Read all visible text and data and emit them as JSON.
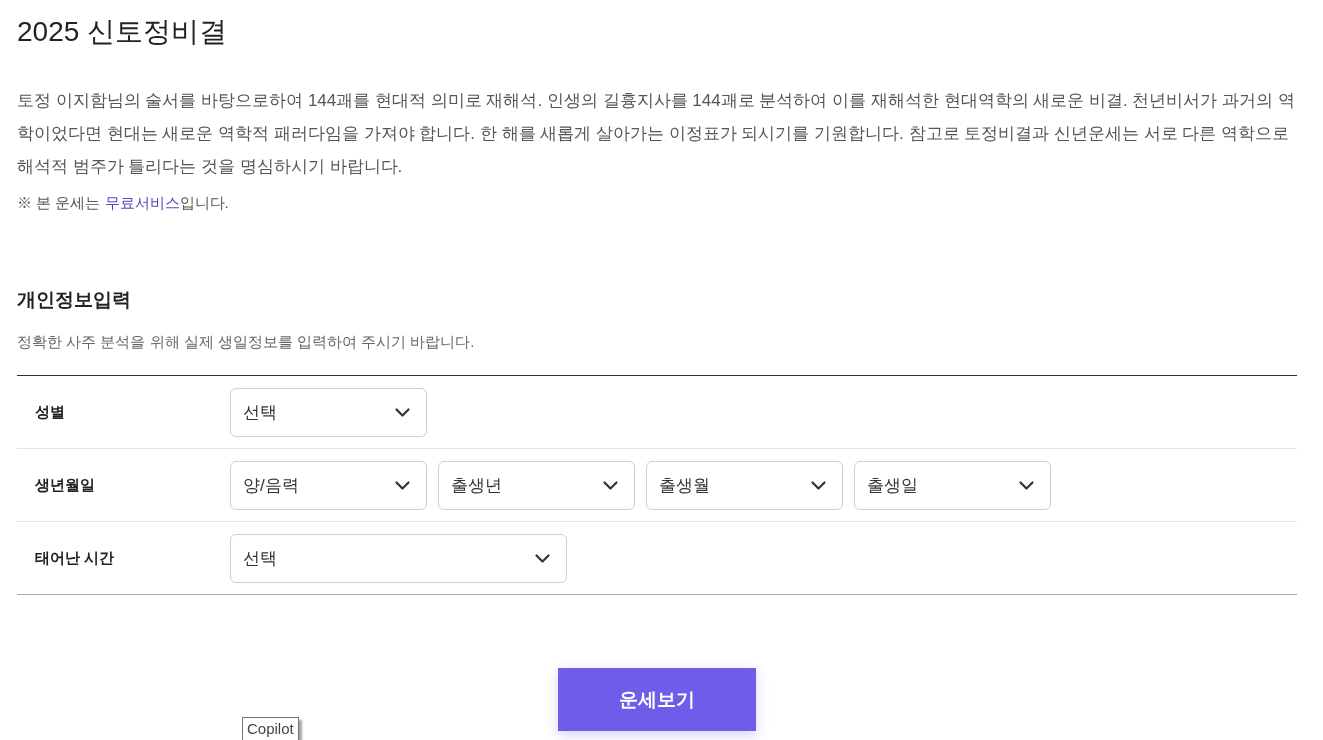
{
  "header": {
    "title": "2025 신토정비결",
    "description": "토정 이지함님의 술서를 바탕으로하여 144괘를 현대적 의미로 재해석. 인생의 길흉지사를 144괘로 분석하여 이를 재해석한 현대역학의 새로운 비결. 천년비서가 과거의 역학이었다면 현대는 새로운 역학적 패러다임을 가져야 합니다. 한 해를 새롭게 살아가는 이정표가 되시기를 기원합니다. 참고로 토정비결과 신년운세는 서로 다른 역학으로 해석적 범주가 틀리다는 것을 명심하시기 바랍니다.",
    "notice": {
      "before": "※ 본 운세는 ",
      "highlight": "무료서비스",
      "after": "입니다."
    }
  },
  "form": {
    "title": "개인정보입력",
    "hint": "정확한 사주 분석을 위해 실제 생일정보를 입력하여 주시기 바랍니다.",
    "rows": [
      {
        "label": "성별",
        "selects": [
          {
            "value": "선택"
          }
        ]
      },
      {
        "label": "생년월일",
        "selects": [
          {
            "value": "양/음력"
          },
          {
            "value": "출생년"
          },
          {
            "value": "출생월"
          },
          {
            "value": "출생일"
          }
        ]
      },
      {
        "label": "태어난 시간",
        "selects": [
          {
            "value": "선택"
          }
        ]
      }
    ]
  },
  "submit_button": "운세보기",
  "tooltip": "Copilot"
}
